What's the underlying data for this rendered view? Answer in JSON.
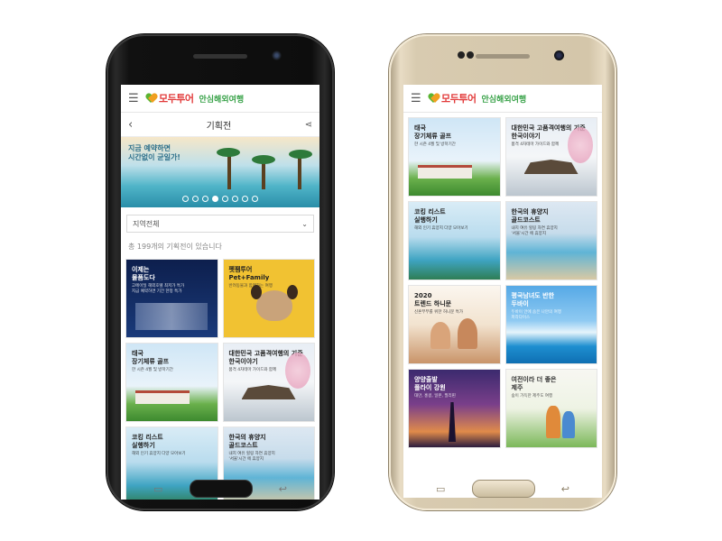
{
  "left_phone": {
    "header": {
      "logo": "모두투어",
      "subtitle": "안심해외여행"
    },
    "subbar": {
      "title": "기획전"
    },
    "banner": {
      "line1": "지금 예약하면",
      "line2": "시간없이 균일가!"
    },
    "region_select": {
      "value": "지역전체"
    },
    "count_text": "총 199개의 기획전이 있습니다",
    "cards": [
      {
        "title": "이제는\n물품도다",
        "sub": "고메이딜 해외호텔 최저가 특가\n지금 예약하면 기간 한정 특가"
      },
      {
        "title": "펫팸투어\nPet+Family",
        "sub": "반려동물과 함께하는 여행"
      },
      {
        "title": "태국\n장기체류 골프",
        "sub": "한 시즌 4월 및 방학기간"
      },
      {
        "title": "대한민국 고품격여행의 기준\n한국이야기",
        "sub": "품격 4차테마 가이드와 함께"
      },
      {
        "title": "코킹 리스트\n실행하기",
        "sub": "해외 인기 휴양지 다양 모아보기"
      },
      {
        "title": "한국의 휴양지\n골드코스트",
        "sub": "내지 여유 힐링 자연 휴양지\n'서울'시간 에 휴양지"
      }
    ]
  },
  "right_phone": {
    "header": {
      "logo": "모두투어",
      "subtitle": "안심해외여행"
    },
    "cards": [
      {
        "title": "태국\n장기체류 골프",
        "sub": "한 시즌 4월 및 방학기간"
      },
      {
        "title": "대한민국 고품격여행의 기준\n한국이야기",
        "sub": "품격 4차테마 가이드와 함께"
      },
      {
        "title": "코킹 리스트\n실행하기",
        "sub": "해외 인기 휴양지 다양 모아보기"
      },
      {
        "title": "한국의 휴양지\n골드코스트",
        "sub": "내지 여유 힐링 자연 휴양지\n'서울'시간 에 휴양지"
      },
      {
        "title": "2020\n트렌드 하니문",
        "sub": "신혼부부를 위한 허니문 특가"
      },
      {
        "title": "평국남녀도 반한\n두바이",
        "sub": "두바이 안에 숨은 나만의 여행\n파라다이스"
      },
      {
        "title": "양양출발\n플라이 강원",
        "sub": "대만, 홍콩, 일본, 필리핀"
      },
      {
        "title": "여전이라 더 좋은\n제주",
        "sub": "숲이 가득한 제주도 여행"
      }
    ]
  }
}
